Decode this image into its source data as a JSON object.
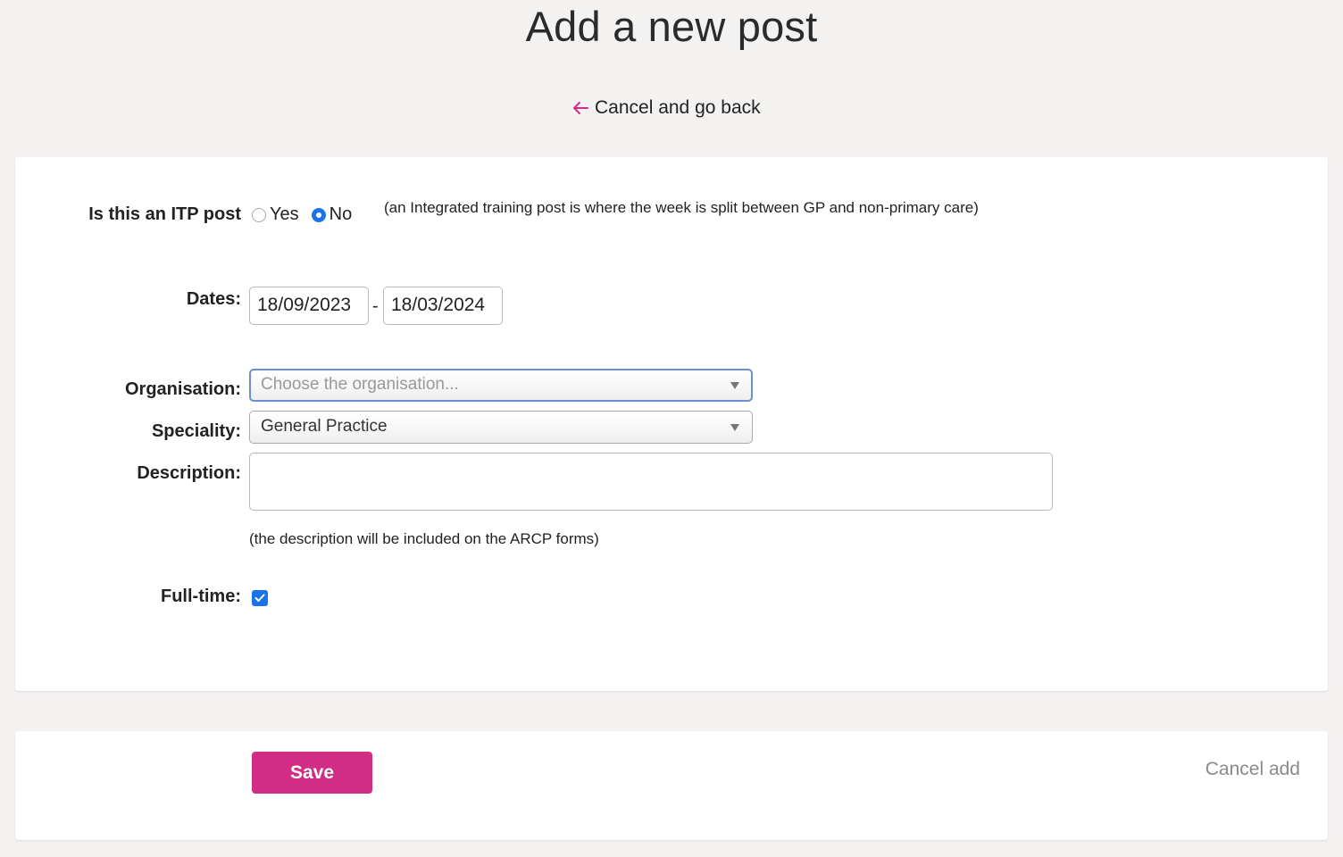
{
  "page": {
    "title": "Add a new post",
    "back_label": "Cancel and go back"
  },
  "colors": {
    "accent": "#d12d84",
    "check_blue": "#1a73e8",
    "background": "#f3f2f1"
  },
  "form": {
    "itp": {
      "label": "Is this an ITP post",
      "options": [
        {
          "label": "Yes",
          "selected": false
        },
        {
          "label": "No",
          "selected": true
        }
      ],
      "hint": "(an Integrated training post is where the week is split between GP and non-primary care)"
    },
    "dates": {
      "label": "Dates:",
      "start": "18/09/2023",
      "separator": "-",
      "end": "18/03/2024"
    },
    "organisation": {
      "label": "Organisation:",
      "placeholder": "Choose the organisation..."
    },
    "speciality": {
      "label": "Speciality:",
      "value": "General Practice"
    },
    "description": {
      "label": "Description:",
      "value": "",
      "hint": "(the description will be included on the ARCP forms)"
    },
    "fulltime": {
      "label": "Full-time:",
      "checked": true
    }
  },
  "actions": {
    "save_label": "Save",
    "cancel_label": "Cancel add"
  }
}
